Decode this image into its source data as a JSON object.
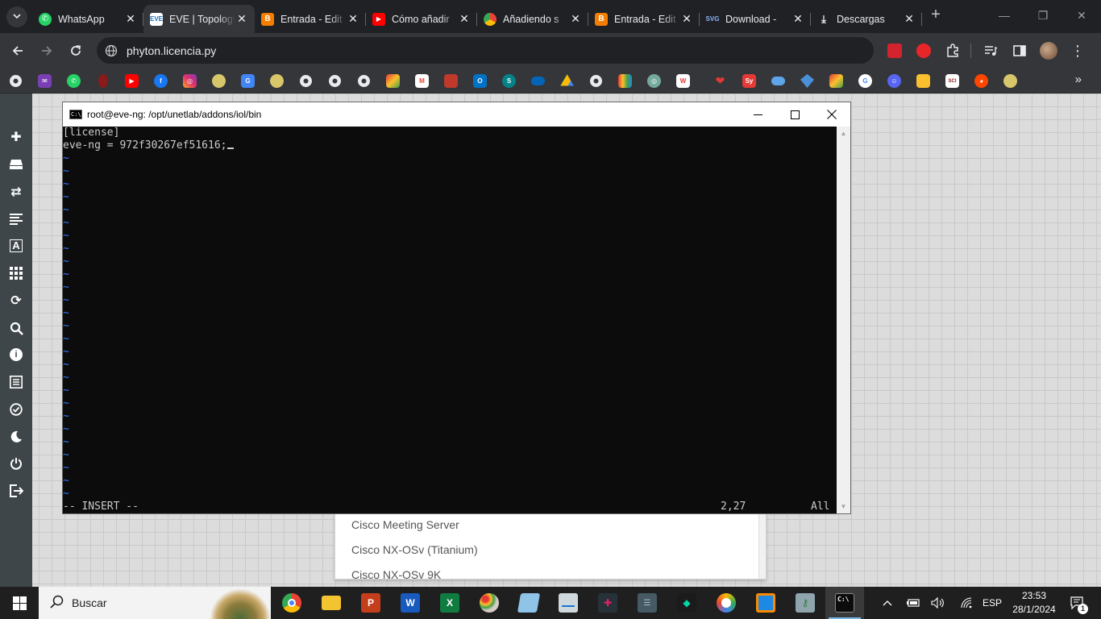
{
  "browser": {
    "tabs": [
      {
        "title": "WhatsApp",
        "icon": "whatsapp-icon",
        "color": "#25d366",
        "active": false
      },
      {
        "title": "EVE | Topology",
        "icon": "eve-icon",
        "color": "#ffffff",
        "active": true
      },
      {
        "title": "Entrada - Edit",
        "icon": "blogger-icon",
        "color": "#f57d00",
        "active": false
      },
      {
        "title": "Cómo añadir",
        "icon": "youtube-icon",
        "color": "#ff0000",
        "active": false
      },
      {
        "title": "Añadiendo s",
        "icon": "chrome-site-icon",
        "color": "#4285f4",
        "active": false
      },
      {
        "title": "Entrada - Edit",
        "icon": "blogger-icon",
        "color": "#f57d00",
        "active": false
      },
      {
        "title": "Download -",
        "icon": "svg-site-icon",
        "color": "#5f6368",
        "active": false
      },
      {
        "title": "Descargas",
        "icon": "download-icon",
        "color": "#e8eaed",
        "active": false
      }
    ],
    "url": "phyton.licencia.py"
  },
  "colors": {
    "chrome_dark": "#202124",
    "chrome_toolbar": "#35363a",
    "eve_sidebar": "#3f4649",
    "terminal_bg": "#0c0c0c",
    "terminal_text": "#cccccc",
    "vim_tilde": "#3b78ff"
  },
  "terminal": {
    "title": "root@eve-ng: /opt/unetlab/addons/iol/bin",
    "icon_label": "C:\\",
    "lines": [
      "[license]",
      "eve-ng = 972f30267ef51616;"
    ],
    "tilde": "~",
    "mode": "-- INSERT --",
    "position": "2,27",
    "scroll": "All"
  },
  "node_list": {
    "items": [
      "Cisco Meeting Server",
      "Cisco NX-OSv (Titanium)",
      "Cisco NX-OSv 9K"
    ]
  },
  "taskbar": {
    "search_placeholder": "Buscar",
    "language": "ESP",
    "time": "23:53",
    "date": "28/1/2024",
    "notification_count": "1"
  }
}
